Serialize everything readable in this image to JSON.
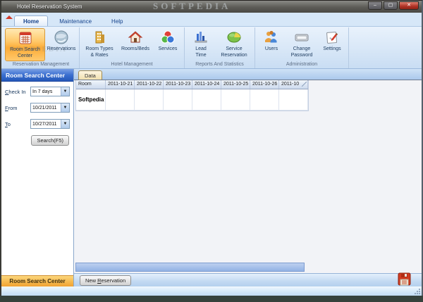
{
  "window": {
    "title": "Hotel Reservation System",
    "watermark": "SOFTPEDIA",
    "buttons": {
      "minimize": "–",
      "maximize": "▢",
      "close": "✕"
    }
  },
  "tabs": [
    {
      "label": "Home",
      "active": true
    },
    {
      "label": "Maintenance",
      "active": false
    },
    {
      "label": "Help",
      "active": false
    }
  ],
  "ribbon": {
    "groups": [
      {
        "label": "Reservation Management",
        "buttons": [
          {
            "label": "Room Search Center",
            "icon": "calendar-search-icon",
            "active": true
          },
          {
            "label": "Reservations",
            "icon": "globe-icon",
            "active": false
          }
        ]
      },
      {
        "label": "Hotel Management",
        "buttons": [
          {
            "label": "Room Types & Rates",
            "icon": "building-icon",
            "active": false
          },
          {
            "label": "Rooms/Beds",
            "icon": "house-icon",
            "active": false
          },
          {
            "label": "Services",
            "icon": "circles-icon",
            "active": false
          }
        ]
      },
      {
        "label": "Reports And Statistics",
        "buttons": [
          {
            "label": "Lead Time",
            "icon": "bar-chart-icon",
            "active": false
          },
          {
            "label": "Service Reservation",
            "icon": "pie-chart-icon",
            "active": false
          }
        ]
      },
      {
        "label": "Administration",
        "buttons": [
          {
            "label": "Users",
            "icon": "users-icon",
            "active": false
          },
          {
            "label": "Change Password",
            "icon": "keyboard-icon",
            "active": false
          },
          {
            "label": "Settings",
            "icon": "settings-icon",
            "active": false
          }
        ]
      }
    ]
  },
  "sidebar": {
    "header": "Room Search Center",
    "fields": [
      {
        "label": "Check In",
        "value": "In 7 days"
      },
      {
        "label": "From",
        "value": "10/21/2011"
      },
      {
        "label": "To",
        "value": "10/27/2011"
      }
    ],
    "search_button": "Search(F5)",
    "footer": "Room Search Center"
  },
  "main": {
    "data_tab": "Data",
    "table": {
      "columns": [
        "Room",
        "2011-10-21",
        "2011-10-22",
        "2011-10-23",
        "2011-10-24",
        "2011-10-25",
        "2011-10-26",
        "2011-10"
      ],
      "rows": [
        {
          "room": "Softpedia"
        }
      ]
    },
    "new_reservation_button": "New Reservation"
  },
  "colors": {
    "accent_orange": "#fcab36",
    "panel_blue": "#2f64c8",
    "ribbon_blue": "#d8e7f7",
    "scrollbar_blue": "#93b2e4",
    "close_red": "#b03225",
    "save_red": "#d03a20"
  }
}
